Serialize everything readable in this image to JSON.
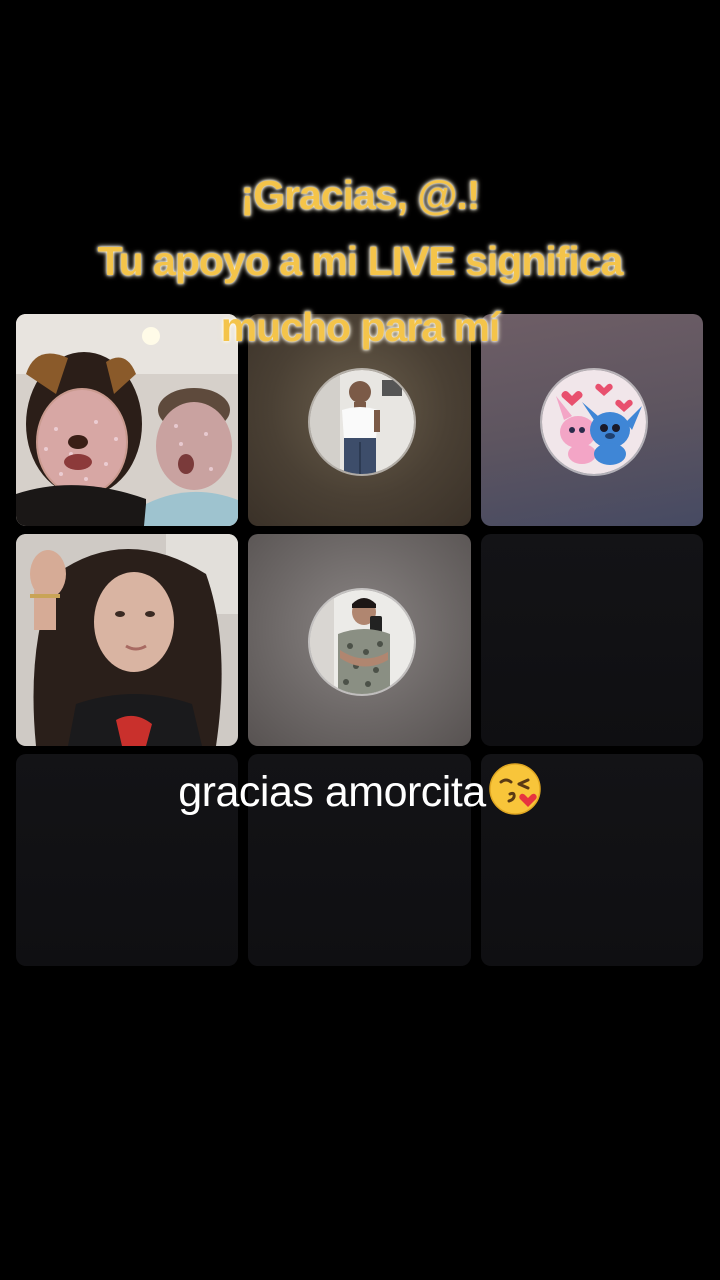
{
  "overlay": {
    "headline_line1": "¡Gracias, @.!",
    "headline_line2": "Tu apoyo a mi LIVE significa",
    "headline_line3": "mucho para mí",
    "caption": "gracias amorcita",
    "caption_emoji": "face-blowing-kiss-icon"
  },
  "colors": {
    "headline": "#f4c44a",
    "caption": "#ffffff",
    "background": "#000000",
    "empty_tile": "#131316"
  },
  "tiles": [
    {
      "slot": 1,
      "kind": "camera",
      "content": "two-faces-with-dog-filter"
    },
    {
      "slot": 2,
      "kind": "avatar",
      "content": "man-mirror-selfie"
    },
    {
      "slot": 3,
      "kind": "avatar",
      "content": "cartoon-couple-illustration"
    },
    {
      "slot": 4,
      "kind": "camera",
      "content": "woman-long-hair"
    },
    {
      "slot": 5,
      "kind": "avatar",
      "content": "young-man-mirror-selfie"
    },
    {
      "slot": 6,
      "kind": "empty"
    },
    {
      "slot": 7,
      "kind": "empty"
    },
    {
      "slot": 8,
      "kind": "empty"
    },
    {
      "slot": 9,
      "kind": "empty"
    }
  ]
}
